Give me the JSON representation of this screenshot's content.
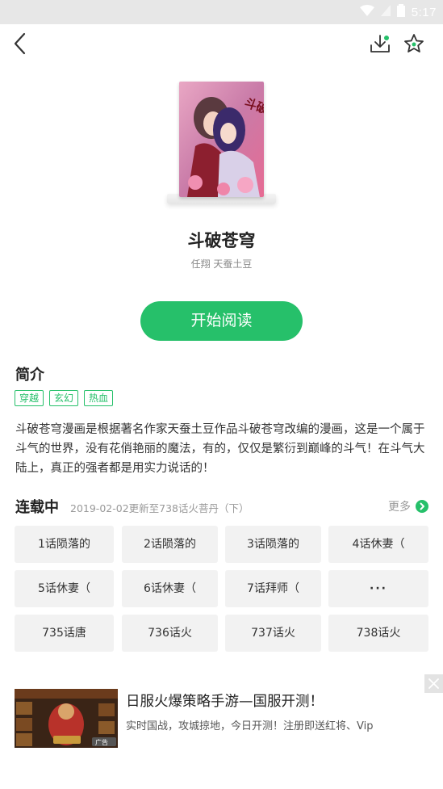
{
  "status_bar": {
    "time": "5:17"
  },
  "book": {
    "title": "斗破苍穹",
    "authors": "任翔 天蚕土豆",
    "cover_text": "斗破苍穹"
  },
  "actions": {
    "start_reading": "开始阅读"
  },
  "intro": {
    "heading": "简介",
    "tags": [
      "穿越",
      "玄幻",
      "热血"
    ],
    "description": "斗破苍穹漫画是根据著名作家天蚕土豆作品斗破苍穹改编的漫画，这是一个属于斗气的世界，没有花俏艳丽的魔法，有的，仅仅是繁衍到巅峰的斗气！在斗气大陆上，真正的强者都是用实力说话的！"
  },
  "serial": {
    "heading": "连载中",
    "update": "2019-02-02更新至738话火菩丹（下）",
    "more": "更多",
    "chapters": [
      "1话陨落的",
      "2话陨落的",
      "3话陨落的",
      "4话休妻（",
      "5话休妻（",
      "6话休妻（",
      "7话拜师（",
      "···",
      "735话唐",
      "736话火",
      "737话火",
      "738话火"
    ]
  },
  "ad": {
    "title": "日服火爆策略手游—国服开测！",
    "description": "实时国战，攻城掠地，今日开测！注册即送红将、Vip",
    "badge": "广告"
  },
  "colors": {
    "accent": "#26c06a",
    "chip_bg": "#f2f2f2"
  }
}
